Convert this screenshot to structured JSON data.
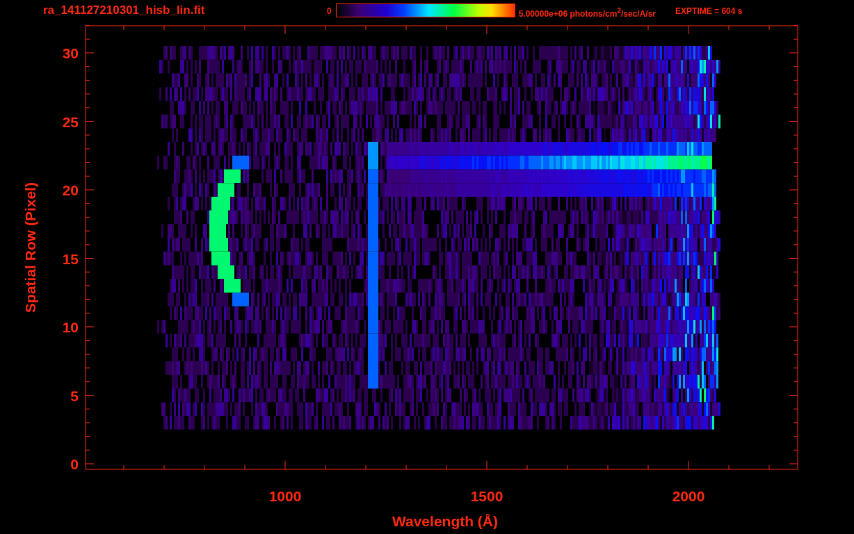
{
  "title": "ra_141127210301_hisb_lin.fit",
  "colorbar": {
    "min_label": "0",
    "max_label": "5.00000e+06 photons/cm$^{2}$/sec/A/sr"
  },
  "exposure": "EXPTIME = 604 s",
  "plot": {
    "xlabel": "Wavelength (Å)",
    "ylabel": "Spatial Row (Pixel)",
    "xtick_labels": [
      "1000",
      "1500",
      "2000"
    ],
    "ytick_labels": [
      "30",
      "25",
      "20",
      "15",
      "10",
      "5",
      "0"
    ]
  }
}
